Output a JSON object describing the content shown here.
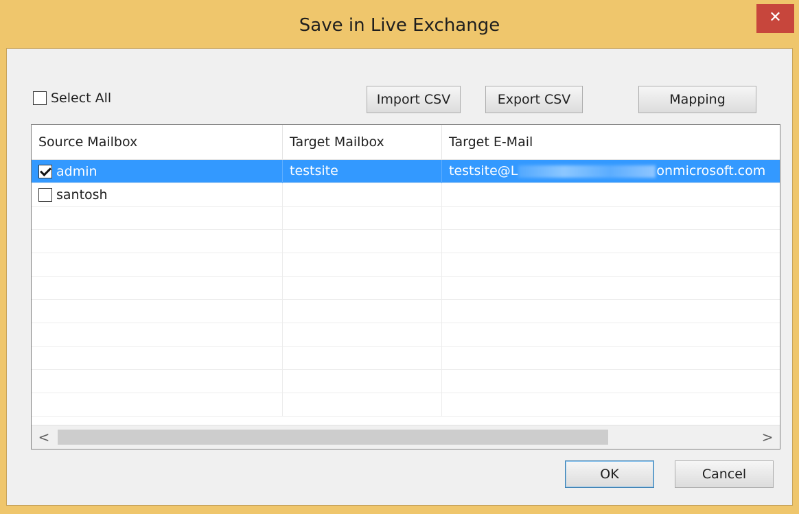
{
  "window": {
    "title": "Save in Live Exchange",
    "close_glyph": "✕",
    "frame_color": "#efc66c",
    "close_color": "#c7463c"
  },
  "toolbar": {
    "select_all_label": "Select All",
    "select_all_checked": false,
    "import_csv_label": "Import CSV",
    "export_csv_label": "Export CSV",
    "mapping_label": "Mapping"
  },
  "grid": {
    "columns": [
      "Source Mailbox",
      "Target Mailbox",
      "Target E-Mail"
    ],
    "rows": [
      {
        "checked": true,
        "selected": true,
        "source": "admin",
        "target": "testsite",
        "email_prefix": "testsite@L",
        "email_suffix": "onmicrosoft.com"
      },
      {
        "checked": false,
        "selected": false,
        "source": "santosh",
        "target": "",
        "email_prefix": "",
        "email_suffix": ""
      }
    ],
    "empty_rows": 9,
    "selection_color": "#3399ff",
    "scroll_left_glyph": "<",
    "scroll_right_glyph": ">"
  },
  "footer": {
    "ok_label": "OK",
    "cancel_label": "Cancel"
  }
}
